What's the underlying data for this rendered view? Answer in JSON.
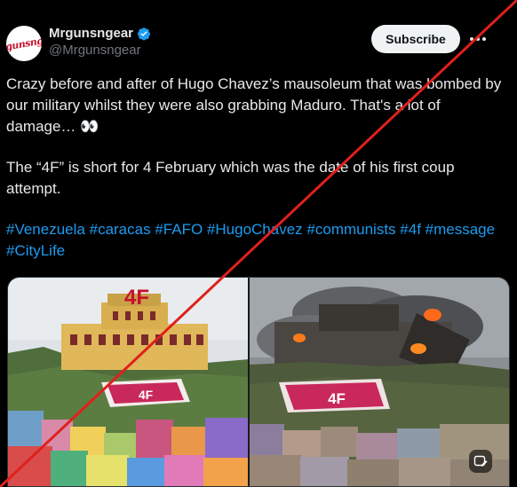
{
  "author": {
    "display_name": "Mrgunsngear",
    "handle": "@Mrgunsngear",
    "avatar_text": "gunsng",
    "verified_icon": "verified-badge-icon",
    "verified_color": "#1d9bf0"
  },
  "actions": {
    "subscribe_label": "Subscribe",
    "more_icon": "more-icon"
  },
  "post": {
    "line1": "Crazy before and after of Hugo Chavez’s mausoleum that was bombed by our military whilst they were also grabbing Maduro.    That's a lot of damage… 👀",
    "line2": "The “4F” is short for 4 February which was the date of his first coup attempt.",
    "hashtags": [
      "#Venezuela",
      "#caracas",
      "#FAFO",
      "#HugoChavez",
      "#communists",
      "#4f",
      "#message",
      "#CityLife"
    ]
  },
  "media": {
    "left_sign": "4F",
    "left_hill_sign": "4F",
    "right_hill_sign": "4F",
    "alt_icon": "image-edit-icon"
  },
  "overlay": {
    "line_color": "#e0201c"
  },
  "colors": {
    "background": "#000000",
    "text": "#e7e9ea",
    "muted": "#71767b",
    "link": "#1d9bf0"
  }
}
